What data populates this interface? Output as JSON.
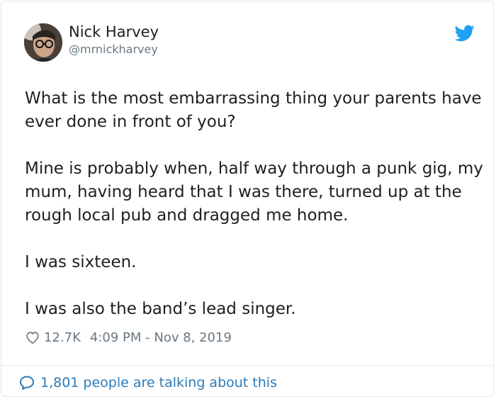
{
  "author": {
    "name": "Nick Harvey",
    "handle": "@mrnickharvey"
  },
  "tweet": {
    "paragraphs": [
      "What is the most embarrassing thing your parents have ever done in front of you?",
      "Mine is probably when, half way through a punk gig, my mum, having heard that I was there, turned up at the rough local pub and dragged me home.",
      "I was sixteen.",
      "I was also the band’s lead singer."
    ],
    "likes": "12.7K",
    "timestamp": "4:09 PM - Nov 8, 2019"
  },
  "footer": {
    "talking_text": "1,801 people are talking about this"
  },
  "icons": {
    "brand": "twitter-bird-icon",
    "like": "heart-icon",
    "reply": "speech-bubble-icon"
  },
  "colors": {
    "twitter_blue": "#1da1f2",
    "link_blue": "#2b7bb9",
    "muted": "#697882"
  }
}
